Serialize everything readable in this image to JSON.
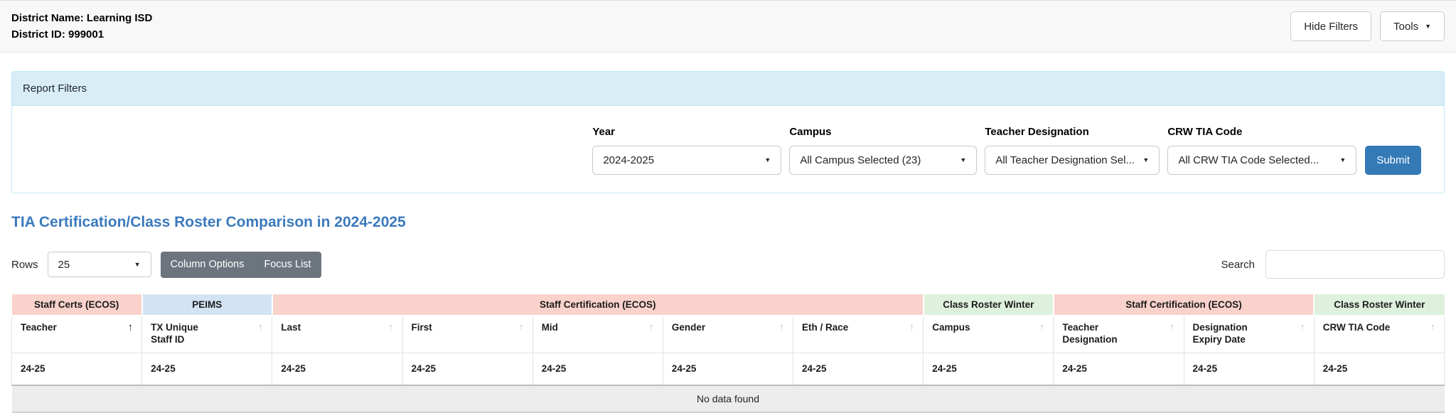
{
  "header": {
    "district_name": "District Name: Learning ISD",
    "district_id": "District ID: 999001",
    "hide_filters_button": "Hide Filters",
    "tools_button": "Tools"
  },
  "filters_panel": {
    "title": "Report Filters",
    "fields": [
      {
        "label": "Year",
        "value": "2024-2025"
      },
      {
        "label": "Campus",
        "value": "All Campus Selected (23)"
      },
      {
        "label": "Teacher Designation",
        "value": "All Teacher Designation Sel..."
      },
      {
        "label": "CRW TIA Code",
        "value": "All CRW TIA Code Selected..."
      }
    ],
    "submit_button": "Submit"
  },
  "report": {
    "title": "TIA Certification/Class Roster Comparison in 2024-2025",
    "rows_label": "Rows",
    "rows_value": "25",
    "column_options_button": "Column Options",
    "focus_list_button": "Focus List",
    "search_label": "Search",
    "search_value": ""
  },
  "table": {
    "group_headers": [
      {
        "label": "Staff Certs (ECOS)",
        "span": 1,
        "color": "#f9d2cb"
      },
      {
        "label": "PEIMS",
        "span": 1,
        "color": "#d2e4f3"
      },
      {
        "label": "Staff Certification (ECOS)",
        "span": 5,
        "color": "#f9d2cb"
      },
      {
        "label": "Class Roster Winter",
        "span": 1,
        "color": "#def1dd"
      },
      {
        "label": "Staff Certification (ECOS)",
        "span": 2,
        "color": "#f9d2cb"
      },
      {
        "label": "Class Roster Winter",
        "span": 1,
        "color": "#def1dd"
      }
    ],
    "columns": [
      {
        "label": "Teacher",
        "sorted": true,
        "stacked": false
      },
      {
        "label": "TX Unique Staff ID",
        "sorted": false,
        "stacked": true
      },
      {
        "label": "Last",
        "sorted": false,
        "stacked": false
      },
      {
        "label": "First",
        "sorted": false,
        "stacked": false
      },
      {
        "label": "Mid",
        "sorted": false,
        "stacked": false
      },
      {
        "label": "Gender",
        "sorted": false,
        "stacked": false
      },
      {
        "label": "Eth / Race",
        "sorted": false,
        "stacked": false
      },
      {
        "label": "Campus",
        "sorted": false,
        "stacked": false
      },
      {
        "label": "Teacher Designation",
        "sorted": false,
        "stacked": true
      },
      {
        "label": "Designation Expiry Date",
        "sorted": false,
        "stacked": true
      },
      {
        "label": "CRW TIA Code",
        "sorted": false,
        "stacked": false
      }
    ],
    "sort_ascending_icon": "↑",
    "filter_row_value": "24-25",
    "empty_message": "No data found"
  },
  "colors": {
    "submit_blue": "#337ab7",
    "title_blue": "#3b7abd",
    "panel_header_blue": "#d9edf7",
    "button_gray": "#6c757d",
    "group_pink": "#f9d2cb",
    "group_blue": "#d2e4f3",
    "group_green": "#def1dd"
  }
}
